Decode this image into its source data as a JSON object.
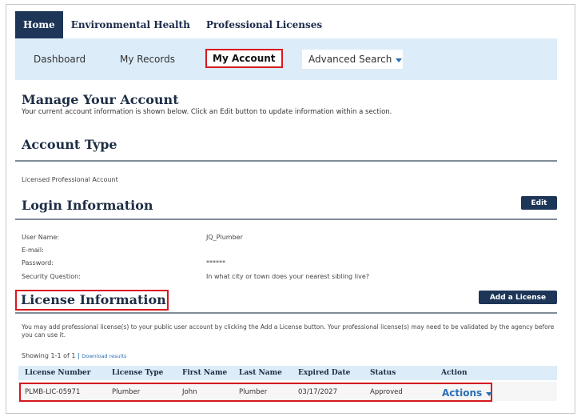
{
  "top_nav": {
    "tabs": [
      {
        "label": "Home",
        "active": true
      },
      {
        "label": "Environmental Health"
      },
      {
        "label": "Professional Licenses"
      }
    ]
  },
  "sub_nav": {
    "dashboard": "Dashboard",
    "my_records": "My Records",
    "my_account": "My Account",
    "advanced_search": "Advanced Search"
  },
  "manage": {
    "title": "Manage Your Account",
    "subtitle": "Your current account information is shown below. Click an Edit button to update information within a section."
  },
  "account_type": {
    "title": "Account Type",
    "value": "Licensed Professional Account"
  },
  "login": {
    "title": "Login Information",
    "edit_label": "Edit",
    "fields": [
      {
        "label": "User Name:",
        "value": "JQ_Plumber"
      },
      {
        "label": "E-mail:",
        "value": ""
      },
      {
        "label": "Password:",
        "value": "******"
      },
      {
        "label": "Security Question:",
        "value": "In what city or town does your nearest sibling live?"
      }
    ]
  },
  "license": {
    "title": "License Information",
    "add_label": "Add a License",
    "description": "You may add professional license(s) to your public user account by clicking the Add a License button. Your professional license(s) may need to be validated by the agency before you can use it.",
    "showing": "Showing 1-1 of 1",
    "separator": "|",
    "download": "Download results",
    "columns": [
      "License Number",
      "License Type",
      "First Name",
      "Last Name",
      "Expired Date",
      "Status",
      "Action"
    ],
    "rows": [
      {
        "number": "PLMB-LIC-05971",
        "type": "Plumber",
        "first": "John",
        "last": "Plumber",
        "expired": "03/17/2027",
        "status": "Approved",
        "action": "Actions"
      }
    ]
  },
  "colors": {
    "navy": "#1d3557",
    "highlight_red": "#d71920",
    "nav_bg": "#dcecf8",
    "link_blue": "#2a6fb5"
  }
}
